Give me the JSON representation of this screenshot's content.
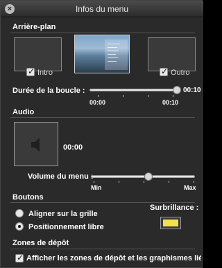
{
  "window": {
    "title": "Infos du menu"
  },
  "background_section": {
    "title": "Arrière-plan",
    "intro_label": "Intro",
    "intro_checked": true,
    "outro_label": "Outro",
    "outro_checked": true,
    "loop_label": "Durée de la boucle :",
    "loop_current": "00:10",
    "loop_min": "00:00",
    "loop_max": "00:10",
    "loop_fraction": 1.0
  },
  "audio_section": {
    "title": "Audio",
    "duration": "00:00",
    "volume_label": "Volume du menu :",
    "volume_min": "Min",
    "volume_max": "Max",
    "volume_fraction": 0.55
  },
  "buttons_section": {
    "title": "Boutons",
    "option_grid": "Aligner sur la grille",
    "option_free": "Positionnement libre",
    "selected_option": "free",
    "highlight_label": "Surbrillance :",
    "highlight_color": "#f2e34c"
  },
  "drop_zones_section": {
    "title": "Zones de dépôt",
    "show_label": "Afficher les zones de dépôt et les graphismes liés",
    "show_checked": true
  },
  "icons": {
    "close": "close-icon",
    "speaker": "speaker-icon"
  }
}
